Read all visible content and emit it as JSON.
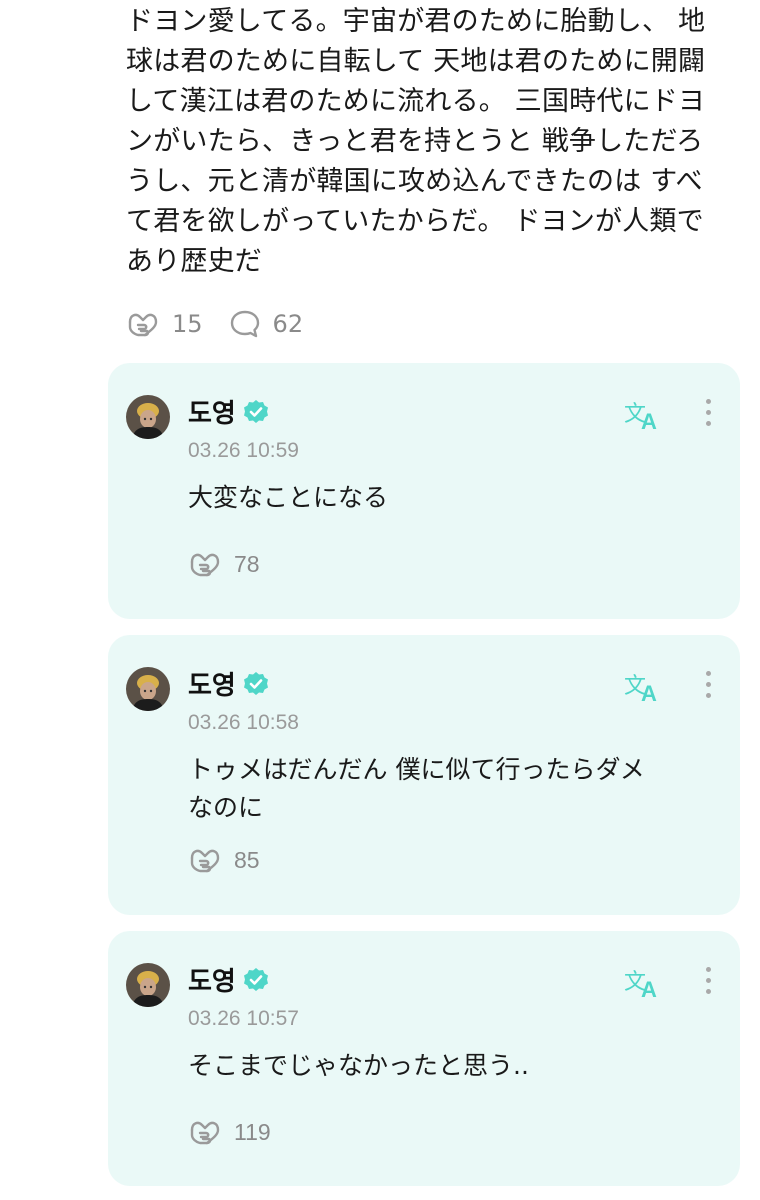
{
  "post": {
    "text": "ドヨン愛してる。宇宙が君のために胎動し、 地\n球は君のために自転して 天地は君のために開闢\nして漢江は君のために流れる。 三国時代にドヨ\nンがいたら、きっと君を持とうと 戦争しただろ\nうし、元と清が韓国に攻め込んできたのは すべ\nて君を欲しがっていたからだ。 ドヨンが人類で\nあり歴史だ",
    "likes": "15",
    "comments": "62"
  },
  "replies": [
    {
      "name": "도영",
      "time": "03.26 10:59",
      "text": "大変なことになる",
      "likes": "78"
    },
    {
      "name": "도영",
      "time": "03.26 10:58",
      "text": "トゥメはだんだん 僕に似て行ったらダメ\nなのに",
      "likes": "85"
    },
    {
      "name": "도영",
      "time": "03.26 10:57",
      "text": "そこまでじゃなかったと思う..",
      "likes": "119"
    }
  ],
  "colors": {
    "accent": "#4fd6c8",
    "card_bg": "#eaf9f7",
    "muted": "#8a8a8a"
  },
  "icons": {
    "like": "heart-hand-icon",
    "comment": "speech-bubble-icon",
    "translate": "translate-icon",
    "more": "more-vertical-icon",
    "verified": "verified-badge-icon"
  }
}
